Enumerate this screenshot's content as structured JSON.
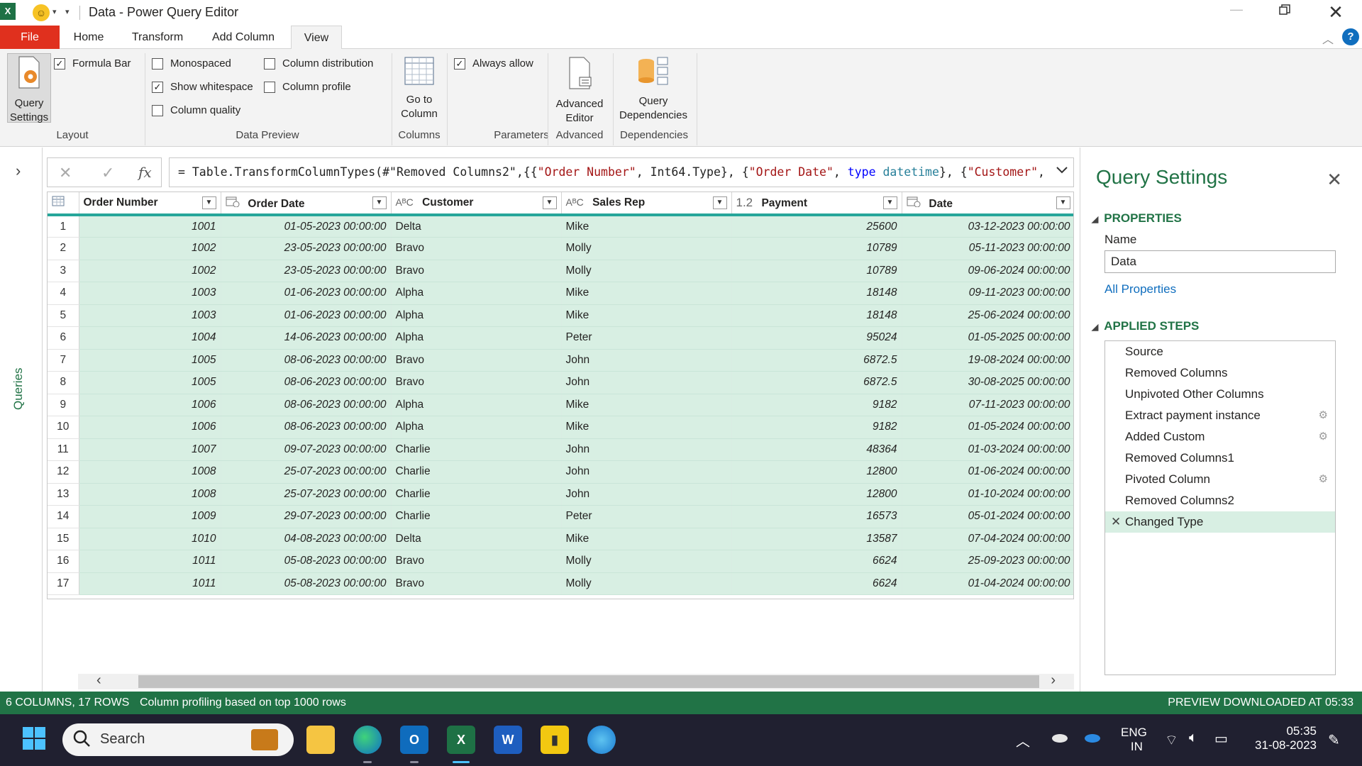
{
  "titlebar": {
    "title": "Data - Power Query Editor",
    "excel_logo": "X"
  },
  "ribbon_tabs": [
    {
      "label": "File"
    },
    {
      "label": "Home"
    },
    {
      "label": "Transform"
    },
    {
      "label": "Add Column"
    },
    {
      "label": "View"
    }
  ],
  "ribbon": {
    "query_settings_btn": "Query Settings",
    "formula_bar": "Formula Bar",
    "monospaced": "Monospaced",
    "show_whitespace": "Show whitespace",
    "column_quality": "Column quality",
    "column_distribution": "Column distribution",
    "column_profile": "Column profile",
    "go_to_column": "Go to Column",
    "always_allow": "Always allow",
    "advanced_editor": "Advanced Editor",
    "query_dependencies": "Query Dependencies",
    "groups": {
      "layout": "Layout",
      "data_preview": "Data Preview",
      "columns": "Columns",
      "parameters": "Parameters",
      "advanced": "Advanced",
      "dependencies": "Dependencies"
    },
    "checks": {
      "formula_bar": true,
      "monospaced": false,
      "show_whitespace": true,
      "column_quality": false,
      "column_distribution": false,
      "column_profile": false,
      "always_allow": true
    }
  },
  "queries_pane": {
    "label": "Queries"
  },
  "formula_bar": {
    "fx": "fx",
    "prefix": "= Table.TransformColumnTypes(#\"Removed Columns2\",{{",
    "s1": "\"Order Number\"",
    "p1": ", Int64.Type}, {",
    "s2": "\"Order Date\"",
    "p2": ", ",
    "kw1": "type",
    "ty1": "datetime",
    "p3": "}, {",
    "s3": "\"Customer\"",
    "p4": ","
  },
  "table": {
    "columns": [
      {
        "name": "Order Number",
        "type_icon": "123"
      },
      {
        "name": "Order Date",
        "type_icon": "datetime"
      },
      {
        "name": "Customer",
        "type_icon": "ABC"
      },
      {
        "name": "Sales Rep",
        "type_icon": "ABC"
      },
      {
        "name": "Payment",
        "type_icon": "1.2"
      },
      {
        "name": "Date",
        "type_icon": "datetime"
      }
    ],
    "col_type_labels": [
      "",
      "",
      "AᴮC",
      "AᴮC",
      "1.2",
      ""
    ],
    "rows": [
      [
        "1",
        "1001",
        "01-05-2023 00:00:00",
        "Delta",
        "Mike",
        "25600",
        "03-12-2023 00:00:00"
      ],
      [
        "2",
        "1002",
        "23-05-2023 00:00:00",
        "Bravo",
        "Molly",
        "10789",
        "05-11-2023 00:00:00"
      ],
      [
        "3",
        "1002",
        "23-05-2023 00:00:00",
        "Bravo",
        "Molly",
        "10789",
        "09-06-2024 00:00:00"
      ],
      [
        "4",
        "1003",
        "01-06-2023 00:00:00",
        "Alpha",
        "Mike",
        "18148",
        "09-11-2023 00:00:00"
      ],
      [
        "5",
        "1003",
        "01-06-2023 00:00:00",
        "Alpha",
        "Mike",
        "18148",
        "25-06-2024 00:00:00"
      ],
      [
        "6",
        "1004",
        "14-06-2023 00:00:00",
        "Alpha",
        "Peter",
        "95024",
        "01-05-2025 00:00:00"
      ],
      [
        "7",
        "1005",
        "08-06-2023 00:00:00",
        "Bravo",
        "John",
        "6872.5",
        "19-08-2024 00:00:00"
      ],
      [
        "8",
        "1005",
        "08-06-2023 00:00:00",
        "Bravo",
        "John",
        "6872.5",
        "30-08-2025 00:00:00"
      ],
      [
        "9",
        "1006",
        "08-06-2023 00:00:00",
        "Alpha",
        "Mike",
        "9182",
        "07-11-2023 00:00:00"
      ],
      [
        "10",
        "1006",
        "08-06-2023 00:00:00",
        "Alpha",
        "Mike",
        "9182",
        "01-05-2024 00:00:00"
      ],
      [
        "11",
        "1007",
        "09-07-2023 00:00:00",
        "Charlie",
        "John",
        "48364",
        "01-03-2024 00:00:00"
      ],
      [
        "12",
        "1008",
        "25-07-2023 00:00:00",
        "Charlie",
        "John",
        "12800",
        "01-06-2024 00:00:00"
      ],
      [
        "13",
        "1008",
        "25-07-2023 00:00:00",
        "Charlie",
        "John",
        "12800",
        "01-10-2024 00:00:00"
      ],
      [
        "14",
        "1009",
        "29-07-2023 00:00:00",
        "Charlie",
        "Peter",
        "16573",
        "05-01-2024 00:00:00"
      ],
      [
        "15",
        "1010",
        "04-08-2023 00:00:00",
        "Delta",
        "Mike",
        "13587",
        "07-04-2024 00:00:00"
      ],
      [
        "16",
        "1011",
        "05-08-2023 00:00:00",
        "Bravo",
        "Molly",
        "6624",
        "25-09-2023 00:00:00"
      ],
      [
        "17",
        "1011",
        "05-08-2023 00:00:00",
        "Bravo",
        "Molly",
        "6624",
        "01-04-2024 00:00:00"
      ]
    ]
  },
  "query_settings": {
    "title": "Query Settings",
    "properties_header": "PROPERTIES",
    "name_label": "Name",
    "name_value": "Data",
    "all_properties": "All Properties",
    "applied_steps_header": "APPLIED STEPS",
    "steps": [
      {
        "label": "Source",
        "gear": false
      },
      {
        "label": "Removed Columns",
        "gear": false
      },
      {
        "label": "Unpivoted Other Columns",
        "gear": false
      },
      {
        "label": "Extract payment instance",
        "gear": true
      },
      {
        "label": "Added Custom",
        "gear": true
      },
      {
        "label": "Removed Columns1",
        "gear": false
      },
      {
        "label": "Pivoted Column",
        "gear": true
      },
      {
        "label": "Removed Columns2",
        "gear": false
      },
      {
        "label": "Changed Type",
        "gear": false,
        "selected": true
      }
    ]
  },
  "status_bar": {
    "columns_rows": "6 COLUMNS, 17 ROWS",
    "profiling": "Column profiling based on top 1000 rows",
    "preview": "PREVIEW DOWNLOADED AT 05:33"
  },
  "taskbar": {
    "search_label": "Search",
    "lang_top": "ENG",
    "lang_bottom": "IN",
    "time": "05:35",
    "date": "31-08-2023"
  },
  "colors": {
    "excel_green": "#217346",
    "selected_row": "#d8efe3",
    "header_underline": "#26a69a",
    "file_tab": "#e0301e"
  }
}
